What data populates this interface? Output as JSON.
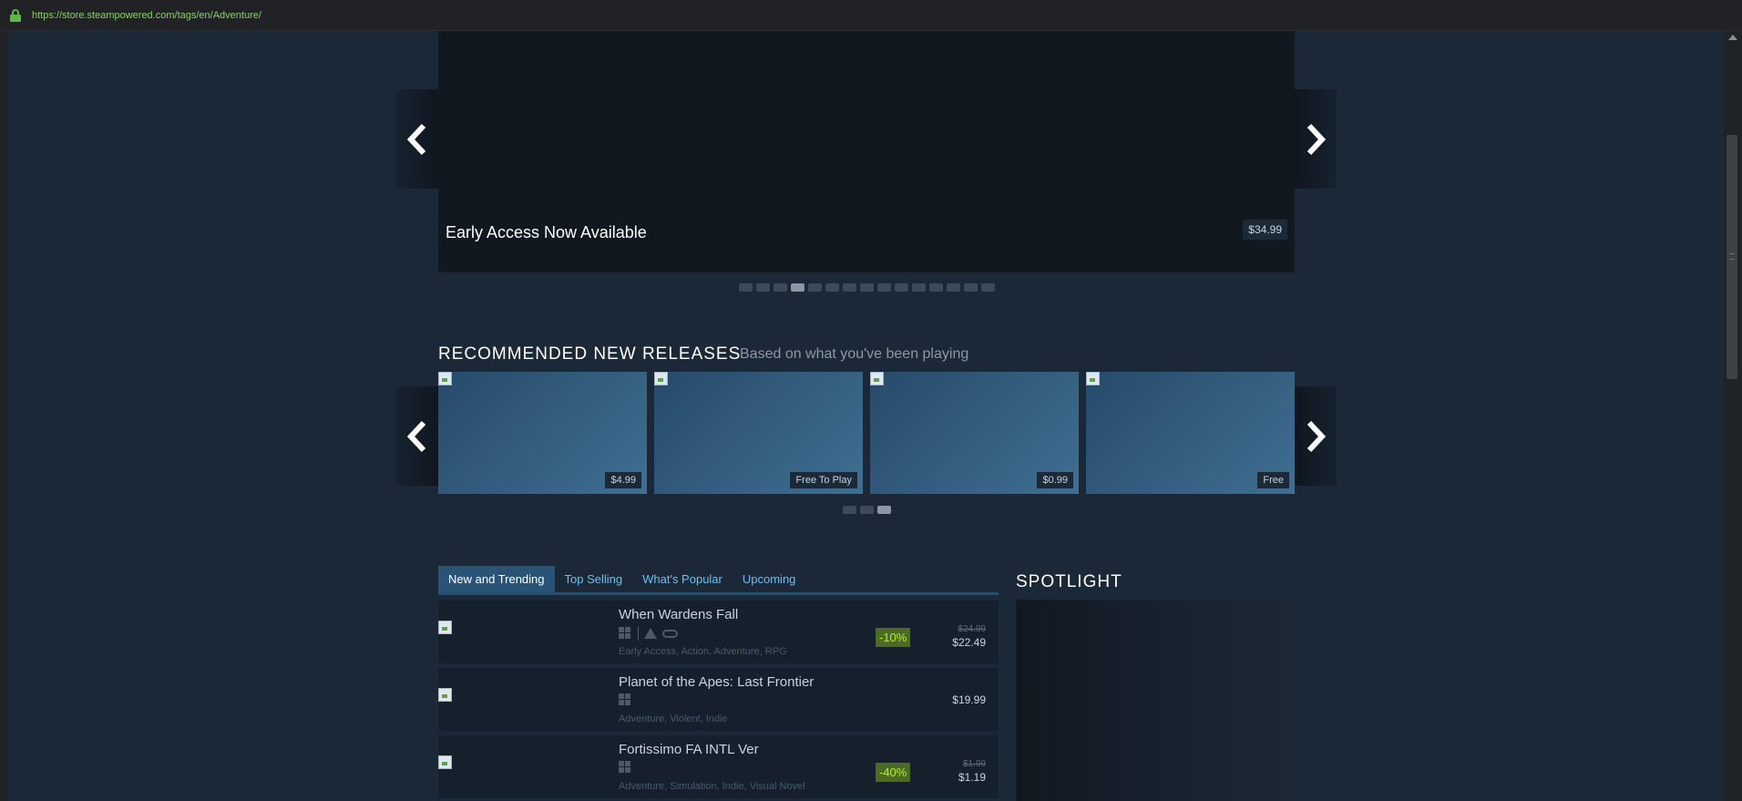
{
  "browser": {
    "url": "https://store.steampowered.com/tags/en/Adventure/"
  },
  "hero": {
    "caption": "Early Access Now Available",
    "price": "$34.99",
    "dot_count": 15,
    "active_dot": 3
  },
  "recommended": {
    "title": "RECOMMENDED NEW RELEASES",
    "subtitle": "Based on what you've been playing",
    "tiles": [
      {
        "price": "$4.99"
      },
      {
        "price": "Free To Play"
      },
      {
        "price": "$0.99"
      },
      {
        "price": "Free"
      }
    ],
    "dot_count": 3,
    "active_dot": 2
  },
  "tabs": [
    {
      "label": "New and Trending",
      "active": true
    },
    {
      "label": "Top Selling",
      "active": false
    },
    {
      "label": "What's Popular",
      "active": false
    },
    {
      "label": "Upcoming",
      "active": false
    }
  ],
  "games": [
    {
      "name": "When Wardens Fall",
      "tags": "Early Access, Action, Adventure, RPG",
      "platforms": [
        "windows-icon",
        "vr-icon"
      ],
      "discount": "-10%",
      "original_price": "$24.99",
      "final_price": "$22.49"
    },
    {
      "name": "Planet of the Apes: Last Frontier",
      "tags": "Adventure, Violent, Indie",
      "platforms": [
        "windows-icon"
      ],
      "discount": "",
      "original_price": "",
      "final_price": "$19.99"
    },
    {
      "name": "Fortissimo FA INTL Ver",
      "tags": "Adventure, Simulation, Indie, Visual Novel",
      "platforms": [
        "windows-icon"
      ],
      "discount": "-40%",
      "original_price": "$1.99",
      "final_price": "$1.19"
    }
  ],
  "spotlight": {
    "title": "SPOTLIGHT"
  }
}
